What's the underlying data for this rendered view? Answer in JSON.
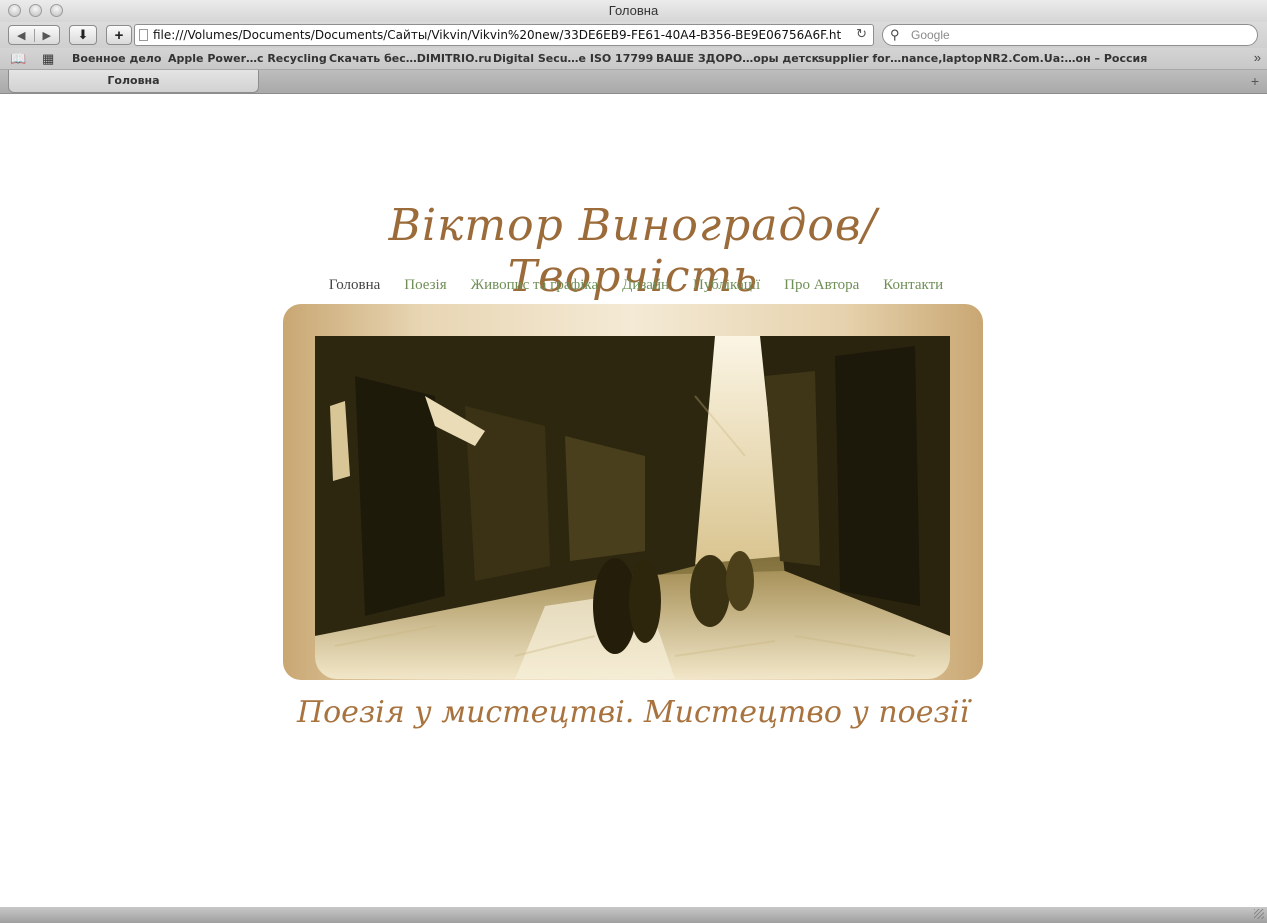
{
  "window": {
    "title": "Головна"
  },
  "toolbar": {
    "url": "file:///Volumes/Documents/Documents/Сайты/Vikvin/Vikvin%20new/33DE6EB9-FE61-40A4-B356-BE9E06756A6F.ht",
    "search_placeholder": "Google",
    "add_label": "+",
    "download_label": "⬇"
  },
  "bookmarks": [
    "Военное дело",
    "Apple Power…c Recycling",
    "Скачать бес…DIMITRIO.ru",
    "Digital Secu…e ISO 17799",
    "ВАШЕ ЗДОРО…оры детск",
    "supplier for…nance,laptop",
    "NR2.Com.Ua:…он – Россия"
  ],
  "tabs": {
    "active_label": "Головна",
    "new_tab_icon": "plus-icon"
  },
  "site": {
    "title": "Віктор Виноградов/Творчість",
    "nav": [
      {
        "label": "Головна",
        "current": true
      },
      {
        "label": "Поезія",
        "current": false
      },
      {
        "label": "Живопис та графіка",
        "current": false
      },
      {
        "label": "Дизайн",
        "current": false
      },
      {
        "label": "Публікації",
        "current": false
      },
      {
        "label": "Про Автора",
        "current": false
      },
      {
        "label": "Контакти",
        "current": false
      }
    ],
    "tagline": "Поезія у мистецтві. Мистецтво у поезії"
  },
  "colors": {
    "title": "#9b6b3a",
    "nav_link": "#6f8f57",
    "nav_current": "#444444",
    "sepia_dark": "#3d3416",
    "sepia_light": "#e8d6b4"
  }
}
